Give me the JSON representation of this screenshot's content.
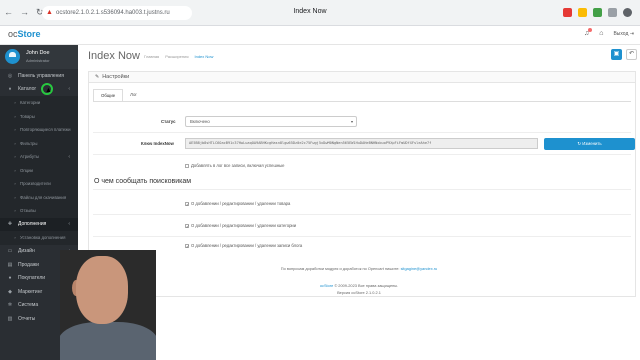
{
  "browser": {
    "url": "ocstore2.1.0.2.1.s536094.ha003.t.justns.ru",
    "tab_title": "Index Now",
    "nav": {
      "back": "←",
      "forward": "→",
      "reload": "↻"
    }
  },
  "header": {
    "logo_prefix": "oc",
    "logo_main": "Store",
    "logout_label": "Выход"
  },
  "sidebar": {
    "user_name": "John Doe",
    "user_role": "Administrator",
    "items": [
      {
        "label": "Панель управления",
        "icon": "dashboard-icon",
        "glyph": "◎"
      },
      {
        "label": "Каталог",
        "icon": "tag-icon",
        "glyph": "⬧",
        "caret": "‹"
      },
      {
        "label": "Категории",
        "sub": true
      },
      {
        "label": "Товары",
        "sub": true
      },
      {
        "label": "Повторяющиеся платежи",
        "sub": true
      },
      {
        "label": "Фильтры",
        "sub": true
      },
      {
        "label": "Атрибуты",
        "sub": true,
        "caret": "‹"
      },
      {
        "label": "Опции",
        "sub": true
      },
      {
        "label": "Производители",
        "sub": true
      },
      {
        "label": "Файлы для скачивания",
        "sub": true
      },
      {
        "label": "Отзывы",
        "sub": true
      },
      {
        "label": "Дополнения",
        "icon": "puzzle-icon",
        "glyph": "✚",
        "caret": "‹",
        "active": true
      },
      {
        "label": "Установка дополнения",
        "sub": true
      },
      {
        "label": "Дизайн",
        "icon": "monitor-icon",
        "glyph": "▭",
        "caret": "‹"
      },
      {
        "label": "Продажи",
        "icon": "cart-icon",
        "glyph": "▤",
        "caret": "‹"
      },
      {
        "label": "Покупатели",
        "icon": "user-icon",
        "glyph": "●",
        "caret": "‹"
      },
      {
        "label": "Маркетинг",
        "icon": "share-icon",
        "glyph": "◆",
        "caret": "‹"
      },
      {
        "label": "Система",
        "icon": "cog-icon",
        "glyph": "✲",
        "caret": "‹"
      },
      {
        "label": "Отчеты",
        "icon": "bar-chart-icon",
        "glyph": "▥",
        "caret": "‹"
      }
    ]
  },
  "page": {
    "title": "Index Now",
    "breadcrumb": [
      "Главная",
      "Расширения",
      "Index Now"
    ]
  },
  "panel": {
    "title": "Настройки",
    "tabs": [
      "Общие",
      "Лог"
    ],
    "status_label": "Статус",
    "status_value": "Включено",
    "key_label": "Ключ IndexNow",
    "key_value": "AE5B8jb8sHTLC6OacB91c37HwLuaqOA9ABHKcgHasn8lgw65Dz0e2c75Fwgj5xDwM0NgNen565EW1HuDAHeBNHNxbuoP9XpFiFmUDfXFsleAhe7f",
    "change_button": "Изменить",
    "log_checkbox": "Добавлять в лог все записи, включая успешные",
    "notify_heading": "О чем сообщать поисковикам",
    "notify_options": [
      "О добавлении / редактировании / удалении товара",
      "О добавлении / редактировании / удалении категории",
      "О добавлении / редактировании / удалении записи блога"
    ]
  },
  "footer": {
    "support_text": "По вопросам доработки модуля и доработок по Opencart пишите:",
    "support_email": "sitgagine@yandex.ru",
    "brand": "ocStore",
    "copyright": "© 2009-2023 Все права защищены.",
    "version": "Версия ocStore 2.1.0.2.1"
  },
  "colors": {
    "accent": "#1e91cf",
    "sidebar": "#2a2e33"
  }
}
